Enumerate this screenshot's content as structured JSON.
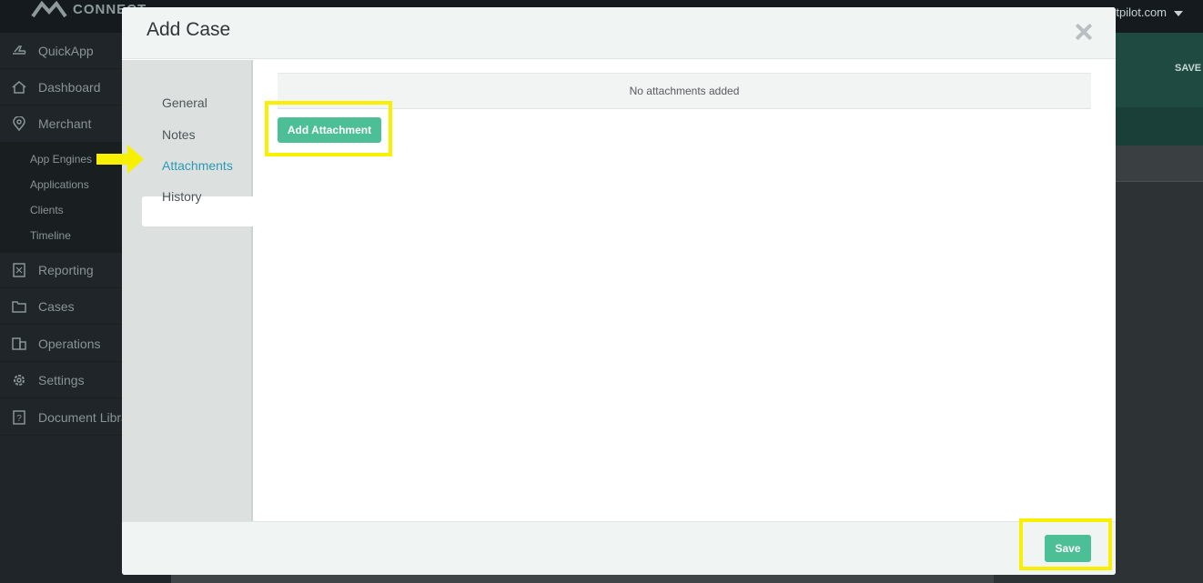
{
  "app": {
    "logo_text": "CONNECT",
    "user_email": "entpilot.com",
    "top_save_label": "SAVE"
  },
  "sidebar": {
    "items": [
      {
        "label": "QuickApp",
        "icon": "plane-icon"
      },
      {
        "label": "Dashboard",
        "icon": "home-icon"
      },
      {
        "label": "Merchant",
        "icon": "location-pin-icon"
      },
      {
        "label": "Reporting",
        "icon": "report-icon"
      },
      {
        "label": "Cases",
        "icon": "folder-icon"
      },
      {
        "label": "Operations",
        "icon": "building-icon"
      },
      {
        "label": "Settings",
        "icon": "gear-icon"
      },
      {
        "label": "Document Libra",
        "icon": "help-doc-icon"
      }
    ],
    "sub_items": [
      "App Engines",
      "Applications",
      "Clients",
      "Timeline"
    ]
  },
  "modal": {
    "title": "Add Case",
    "tabs": [
      {
        "label": "General"
      },
      {
        "label": "Notes"
      },
      {
        "label": "Attachments"
      },
      {
        "label": "History"
      }
    ],
    "active_tab": "Attachments",
    "empty_message": "No attachments added",
    "add_button_label": "Add Attachment",
    "save_button_label": "Save"
  },
  "colors": {
    "accent_green": "#4cbf96",
    "active_tab_text": "#2b9ab4",
    "highlight_yellow": "#f7f000"
  }
}
